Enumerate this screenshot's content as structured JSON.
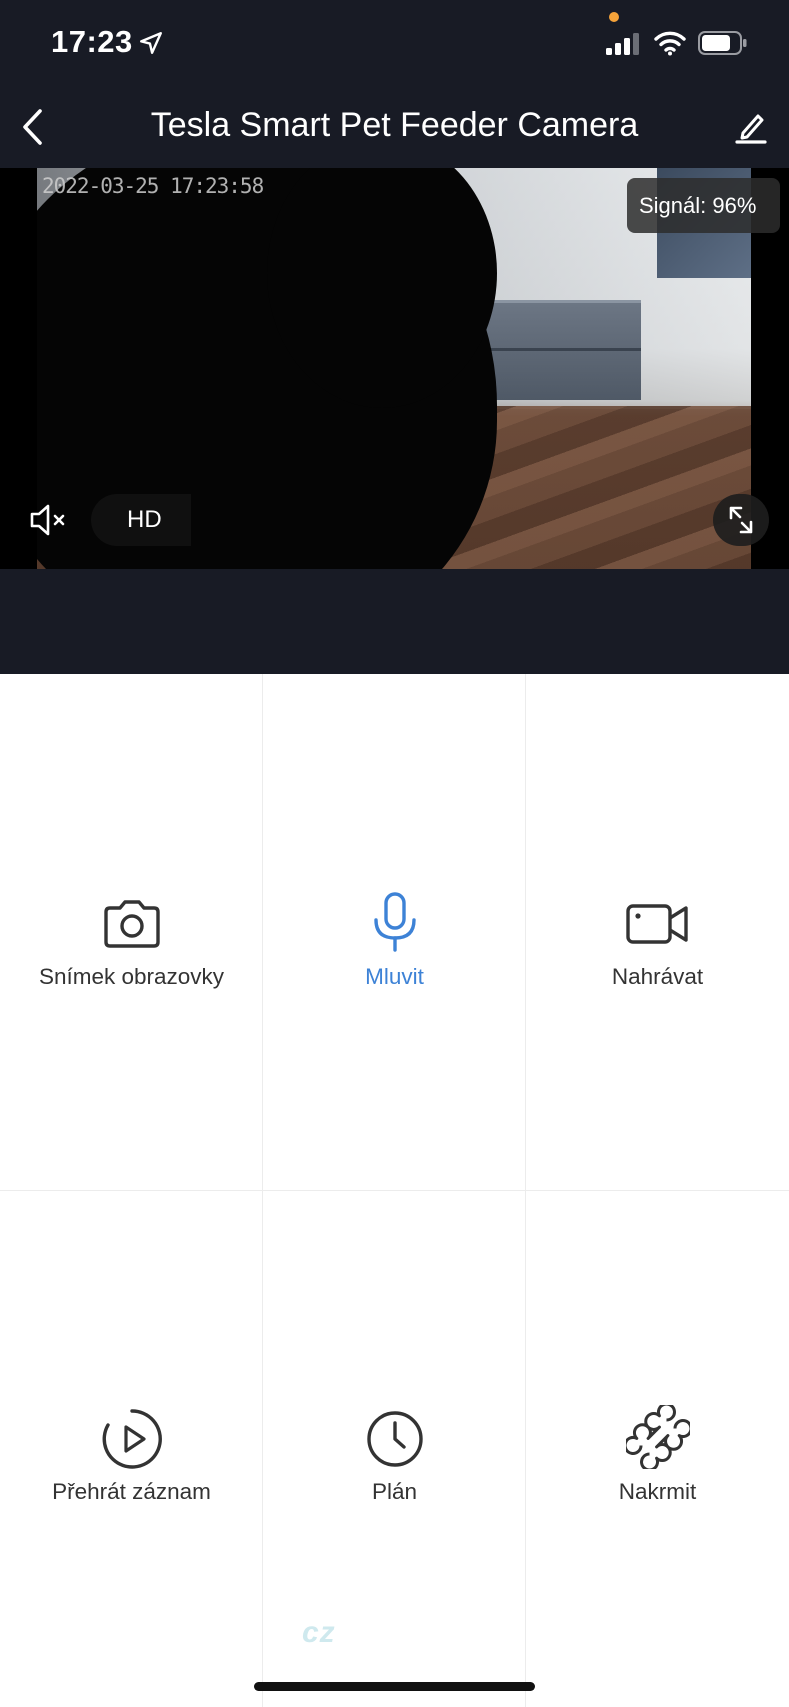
{
  "status_bar": {
    "time": "17:23",
    "icons": [
      "location-arrow-icon",
      "signal-bars-icon",
      "wifi-icon",
      "battery-icon"
    ],
    "privacy_dot_color": "#f5a33a"
  },
  "nav": {
    "title": "Tesla Smart Pet Feeder Camera",
    "back_icon": "chevron-left-icon",
    "edit_icon": "pencil-icon"
  },
  "video": {
    "timestamp": "2022-03-25  17:23:58",
    "signal_label": "Signál: 96%",
    "quality_label": "HD",
    "mute_icon": "speaker-muted-icon",
    "fullscreen_icon": "expand-icon"
  },
  "controls": [
    {
      "label": "Snímek obrazovky",
      "icon": "camera-icon",
      "active": false
    },
    {
      "label": "Mluvit",
      "icon": "microphone-icon",
      "active": true
    },
    {
      "label": "Nahrávat",
      "icon": "video-camera-icon",
      "active": false
    },
    {
      "label": "Přehrát záznam",
      "icon": "replay-icon",
      "active": false
    },
    {
      "label": "Plán",
      "icon": "clock-icon",
      "active": false
    },
    {
      "label": "Nakrmit",
      "icon": "bone-icon",
      "active": false
    }
  ],
  "watermark": "cz",
  "colors": {
    "header_bg": "#181b25",
    "accent": "#3d82d6",
    "text": "#333333"
  }
}
